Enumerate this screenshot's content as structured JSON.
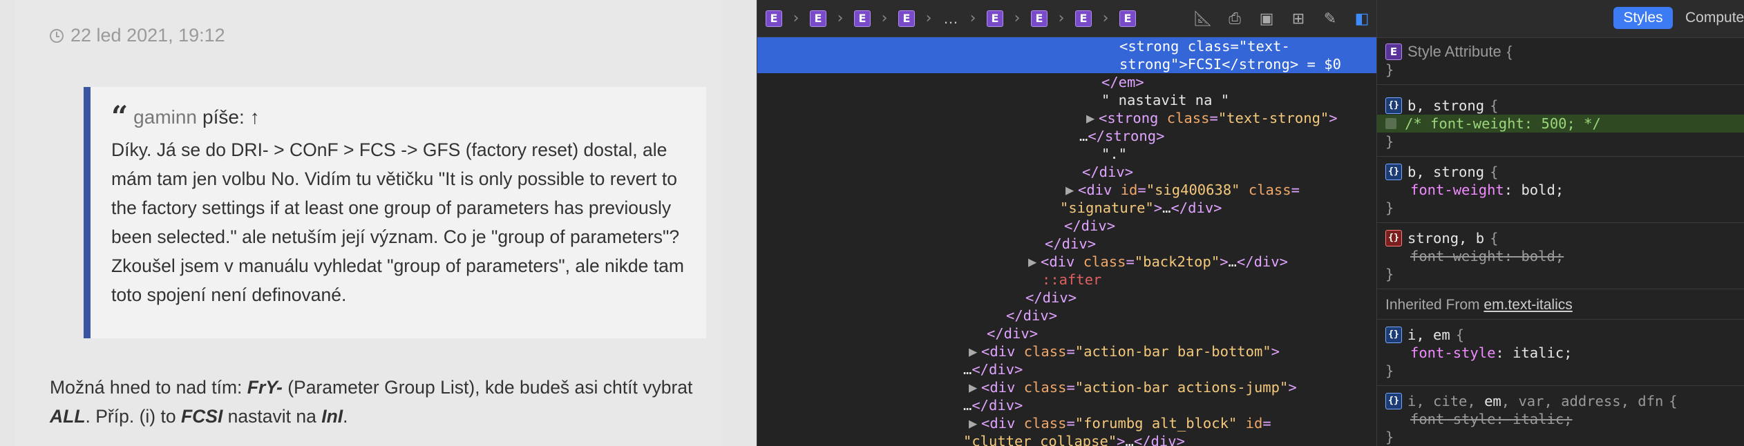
{
  "page": {
    "timestamp": "22 led 2021, 19:12",
    "quote": {
      "author": "gaminn",
      "verb": "píše:",
      "arrow": "↑",
      "text": "Díky. Já se do DRI- > COnF > FCS -> GFS (factory reset) dostal, ale mám tam jen volbu No. Vidím tu větičku \"It is only possible to revert to the factory settings if at least one group of parameters has previously been selected.\" ale netuším její význam. Co je \"group of parameters\"? Zkoušel jsem v manuálu vyhledat \"group of parameters\", ale nikde tam toto spojení není definované."
    },
    "body": {
      "p1": "Možná hned to nad tím: ",
      "b1": "FrY-",
      "p2": " (Parameter Group List), kde budeš asi chtít vybrat ",
      "b2": "ALL",
      "p3": ". Příp. (i) to ",
      "b3": "FCSI",
      "p4": " nastavit na ",
      "b4": "InI",
      "p5": "."
    }
  },
  "devtools": {
    "breadcrumb": {
      "element_letter": "E",
      "separator": "›",
      "ellipsis": "…"
    },
    "toolbar_icons": [
      "ruler-icon",
      "print-icon",
      "screenshot-icon",
      "grid-icon",
      "brush-icon",
      "sidebar-icon"
    ],
    "dom_lines": [
      {
        "text": [
          "<strong class=\"text-",
          ""
        ]
      },
      {
        "text": [
          "strong\">FCSI</strong> = $0",
          ""
        ]
      },
      {
        "text": [
          "</em>",
          ""
        ]
      },
      {
        "text": [
          "\" nastavit na \"",
          ""
        ]
      },
      {
        "text": [
          "<strong class=\"text-strong\">",
          ""
        ]
      },
      {
        "text": [
          "…</strong>",
          ""
        ]
      },
      {
        "text": [
          "\".\"",
          ""
        ]
      },
      {
        "text": [
          "</div>",
          ""
        ]
      },
      {
        "text": [
          "<div id=\"sig400638\" class=",
          ""
        ]
      },
      {
        "text": [
          "\"signature\">…</div>",
          ""
        ]
      },
      {
        "text": [
          "</div>",
          ""
        ]
      },
      {
        "text": [
          "</div>",
          ""
        ]
      },
      {
        "text": [
          "<div class=\"back2top\">…</div>",
          ""
        ]
      },
      {
        "text": [
          "::after",
          ""
        ]
      },
      {
        "text": [
          "</div>",
          ""
        ]
      },
      {
        "text": [
          "</div>",
          ""
        ]
      },
      {
        "text": [
          "</div>",
          ""
        ]
      },
      {
        "text": [
          "<div class=\"action-bar bar-bottom\">",
          ""
        ]
      },
      {
        "text": [
          "…</div>",
          ""
        ]
      },
      {
        "text": [
          "<div class=\"action-bar actions-jump\">",
          ""
        ]
      },
      {
        "text": [
          "…</div>",
          ""
        ]
      },
      {
        "text": [
          "<div class=\"forumbg alt_block\" id=",
          ""
        ]
      },
      {
        "text": [
          "\"clutter_collapse\">…</div>",
          ""
        ]
      }
    ],
    "styles": {
      "tab_styles": "Styles",
      "tab_computed": "Computed",
      "style_attribute": "Style Attribute",
      "rule1_selector": "b, strong",
      "rule1_commented": "/* font-weight: 500; */",
      "rule2_selector": "b, strong",
      "rule2_prop": "font-weight",
      "rule2_value": "bold",
      "rule3_selector": "strong, b",
      "rule3_prop": "font-weight",
      "rule3_value": "bold",
      "inherited_label": "Inherited From",
      "inherited_from": "em.text-italics",
      "rule4_selector": "i, em",
      "rule4_prop": "font-style",
      "rule4_value": "italic",
      "rule5_selector_pre": "i, cite, ",
      "rule5_selector_em": "em",
      "rule5_selector_post": ", var, address, dfn",
      "rule5_prop": "font-style",
      "rule5_value": "italic",
      "badge_label": "{}"
    }
  }
}
